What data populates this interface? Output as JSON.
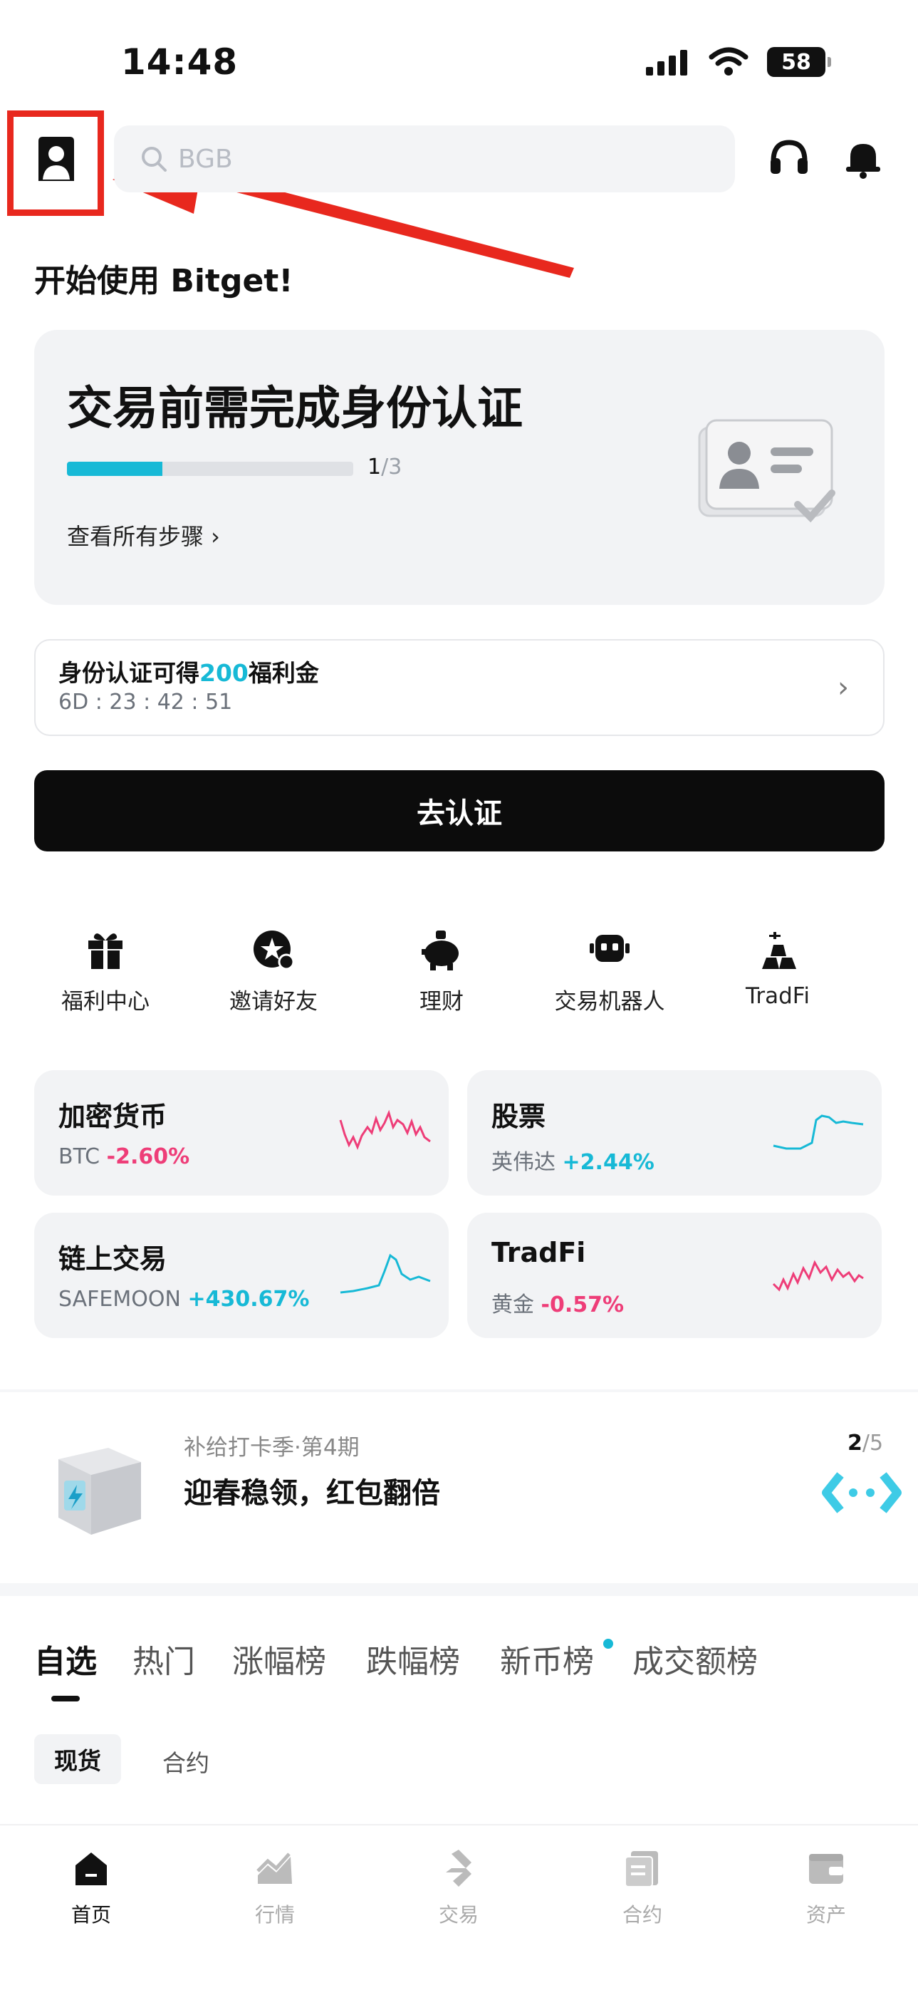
{
  "status_bar": {
    "time": "14:48",
    "battery": "58"
  },
  "header": {
    "search_placeholder": "BGB"
  },
  "welcome": "开始使用 Bitget!",
  "verify_card": {
    "title": "交易前需完成身份认证",
    "progress_current": "1",
    "progress_total": "/3",
    "progress_fraction": 0.333,
    "steps_link": "查看所有步骤 ›"
  },
  "reward": {
    "text_prefix": "身份认证可得",
    "amount": "200",
    "text_suffix": "福利金",
    "timer": "6D : 23 : 42 : 51"
  },
  "primary_button": "去认证",
  "quick_actions": [
    {
      "label": "福利中心",
      "icon": "gift-icon"
    },
    {
      "label": "邀请好友",
      "icon": "invite-icon"
    },
    {
      "label": "理财",
      "icon": "piggy-bank-icon"
    },
    {
      "label": "交易机器人",
      "icon": "robot-icon"
    },
    {
      "label": "TradFi",
      "icon": "gold-bars-icon"
    }
  ],
  "markets": [
    {
      "title": "加密货币",
      "asset": "BTC",
      "change": "-2.60%",
      "trend": "down"
    },
    {
      "title": "股票",
      "asset": "英伟达",
      "change": "+2.44%",
      "trend": "up"
    },
    {
      "title": "链上交易",
      "asset": "SAFEMOON",
      "change": "+430.67%",
      "trend": "up"
    },
    {
      "title": "TradFi",
      "asset": "黄金",
      "change": "-0.57%",
      "trend": "down"
    }
  ],
  "promo": {
    "subtitle": "补给打卡季·第4期",
    "title": "迎春稳领，红包翻倍",
    "page_current": "2",
    "page_total": "/5"
  },
  "tabs": [
    "自选",
    "热门",
    "涨幅榜",
    "跌幅榜",
    "新币榜",
    "成交额榜"
  ],
  "subtabs": [
    "现货",
    "合约"
  ],
  "bottom_nav": [
    {
      "label": "首页",
      "icon": "home-icon",
      "active": true
    },
    {
      "label": "行情",
      "icon": "chart-icon",
      "active": false
    },
    {
      "label": "交易",
      "icon": "trade-icon",
      "active": false
    },
    {
      "label": "合约",
      "icon": "futures-icon",
      "active": false
    },
    {
      "label": "资产",
      "icon": "wallet-icon",
      "active": false
    }
  ],
  "colors": {
    "accent": "#17b9d6",
    "down": "#ee3d78",
    "annotation": "#e8281e"
  }
}
